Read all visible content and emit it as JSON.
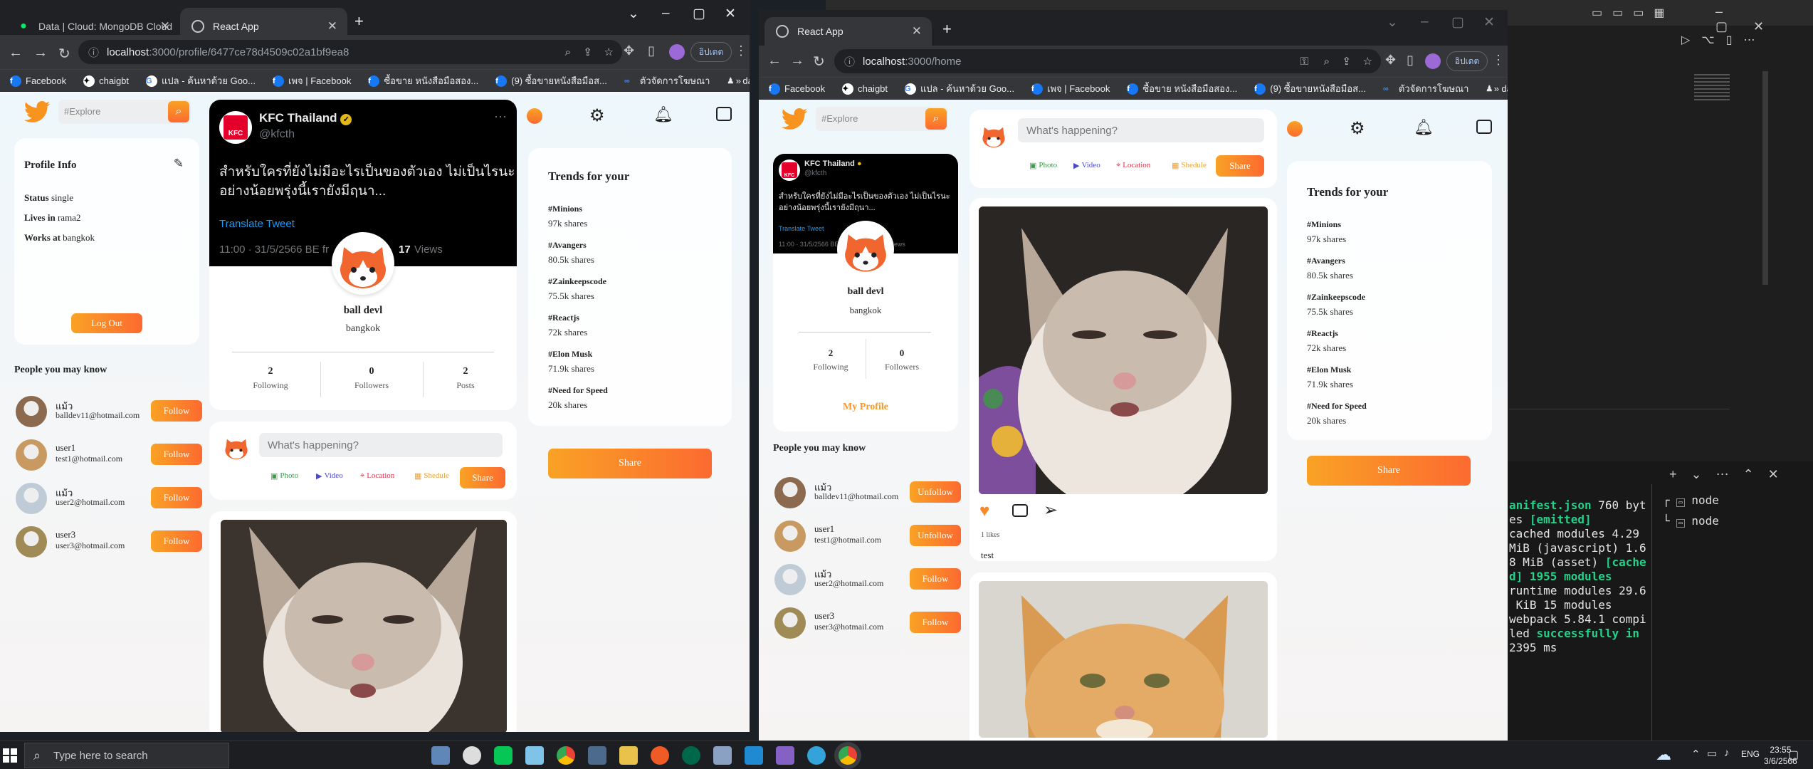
{
  "browser_left": {
    "tabs": [
      "Data | Cloud: MongoDB Cloud",
      "React App"
    ],
    "url_host": "localhost",
    "url_path": ":3000/profile/6477ce78d4509c02a1bf9ea8",
    "profile_badge": "อิปเดต",
    "bookmarks": [
      "Facebook",
      "chaigbt",
      "แปล - ค้นหาด้วย Goo...",
      "เพจ | Facebook",
      "ซื้อขาย หนังสือมือสอง...",
      "(9) ซื้อขายหนังสือมือส...",
      "ตัวจัดการโฆษณา",
      "dark"
    ]
  },
  "browser_right": {
    "tabs": [
      "React App"
    ],
    "url_host": "localhost",
    "url_path": ":3000/home",
    "profile_badge": "อิปเดต",
    "bookmarks": [
      "Facebook",
      "chaigbt",
      "แปล - ค้นหาด้วย Goo...",
      "เพจ | Facebook",
      "ซื้อขาย หนังสือมือสอง...",
      "(9) ซื้อขายหนังสือมือส...",
      "ตัวจัดการโฆษณา",
      "dark"
    ]
  },
  "app": {
    "search_placeholder": "#Explore",
    "profile_info": {
      "title": "Profile Info",
      "status_label": "Status",
      "status_value": "single",
      "lives_label": "Lives in",
      "lives_value": "rama2",
      "works_label": "Works at",
      "works_value": "bangkok",
      "logout": "Log Out"
    },
    "people_title": "People you may know",
    "people": [
      {
        "name": "แม้ว",
        "email": "balldev11@hotmail.com"
      },
      {
        "name": "user1",
        "email": "test1@hotmail.com"
      },
      {
        "name": "แม้ว",
        "email": "user2@hotmail.com"
      },
      {
        "name": "user3",
        "email": "user3@hotmail.com"
      }
    ],
    "follow": "Follow",
    "unfollow": "Unfollow",
    "tweet": {
      "account": "KFC Thailand",
      "handle": "@kfcth",
      "text_line1": "สำหรับใครที่ยังไม่มีอะไรเป็นของตัวเอง ไม่เป็นไรนะ",
      "text_line2": "อย่างน้อยพรุ่งนี้เรายังมีฤนา...",
      "translate": "Translate Tweet",
      "meta": "11:00 · 31/5/2566 BE fr",
      "views_num": "17",
      "views_label": "Views"
    },
    "profile": {
      "name": "ball devl",
      "location": "bangkok",
      "following_count": "2",
      "following_label": "Following",
      "followers_count": "0",
      "followers_label": "Followers",
      "posts_count": "2",
      "posts_label": "Posts",
      "my_profile": "My Profile"
    },
    "share_box": {
      "placeholder": "What's happening?",
      "photo": "Photo",
      "video": "Video",
      "location": "Location",
      "schedule": "Shedule",
      "share": "Share"
    },
    "trends_title": "Trends for your",
    "trends": [
      {
        "tag": "#Minions",
        "shares": "97k shares"
      },
      {
        "tag": "#Avangers",
        "shares": "80.5k shares"
      },
      {
        "tag": "#Zainkeepscode",
        "shares": "75.5k shares"
      },
      {
        "tag": "#Reactjs",
        "shares": "72k shares"
      },
      {
        "tag": "#Elon Musk",
        "shares": "71.9k shares"
      },
      {
        "tag": "#Need for Speed",
        "shares": "20k shares"
      }
    ],
    "big_share": "Share",
    "post": {
      "likes": "1 likes",
      "caption": "test"
    }
  },
  "terminal": {
    "lines": [
      {
        "a": "anifest.json",
        "b": " 760 byt"
      },
      {
        "a": "es ",
        "b": "[emitted]"
      },
      {
        "a": "cached modules 4.29",
        "b": ""
      },
      {
        "a": "MiB (javascript) 1.6",
        "b": ""
      },
      {
        "a": "8 MiB (asset) ",
        "b": "[cache"
      },
      {
        "a": "d]",
        "b": " 1955 modules"
      },
      {
        "a": "runtime modules 29.6",
        "b": ""
      },
      {
        "a": " KiB 15 modules",
        "b": ""
      },
      {
        "a": "webpack 5.84.1 compi",
        "b": ""
      },
      {
        "a": "led ",
        "b": "successfully in"
      },
      {
        "a": "2395 ms",
        "b": ""
      }
    ],
    "tree": [
      "node",
      "node"
    ]
  },
  "taskbar": {
    "search_placeholder": "Type here to search",
    "lang": "ENG",
    "time": "23:55",
    "date": "3/6/2566"
  }
}
